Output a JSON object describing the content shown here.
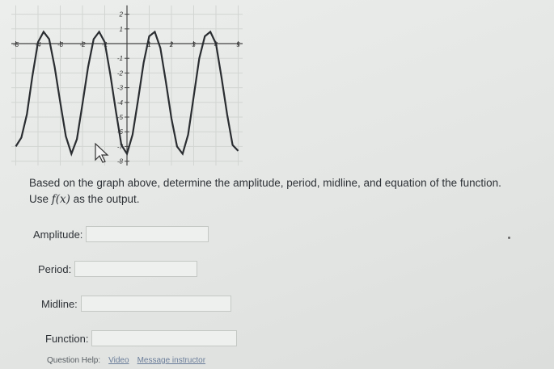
{
  "chart_data": {
    "type": "line",
    "x_tick_labels": [
      "-5",
      "-4",
      "-3",
      "-2",
      "-1",
      "1",
      "2",
      "3",
      "4",
      "5"
    ],
    "y_tick_labels": [
      "2",
      "1",
      "-1",
      "-2",
      "-3",
      "-4",
      "-5",
      "-6",
      "-7",
      "-8"
    ],
    "x_ticks": [
      -5,
      -4,
      -3,
      -2,
      -1,
      1,
      2,
      3,
      4,
      5
    ],
    "y_ticks": [
      2,
      1,
      -1,
      -2,
      -3,
      -4,
      -5,
      -6,
      -7,
      -8
    ],
    "xlim": [
      -5.2,
      5.2
    ],
    "ylim": [
      -8.3,
      2.6
    ],
    "series": [
      {
        "x": [
          -5.0,
          -4.75,
          -4.5,
          -4.25,
          -4.0,
          -3.75,
          -3.5,
          -3.25,
          -3.0,
          -2.75,
          -2.5,
          -2.25,
          -2.0,
          -1.75,
          -1.5,
          -1.25,
          -1.0,
          -0.75,
          -0.5,
          -0.25,
          0.0,
          0.25,
          0.5,
          0.75,
          1.0,
          1.25,
          1.5,
          1.75,
          2.0,
          2.25,
          2.5,
          2.75,
          3.0,
          3.25,
          3.5,
          3.75,
          4.0,
          4.25,
          4.5,
          4.75,
          5.0
        ],
        "y": [
          -7.0,
          -6.4,
          -4.8,
          -2.2,
          0.1,
          0.8,
          0.3,
          -1.6,
          -4.0,
          -6.3,
          -7.5,
          -6.5,
          -4.1,
          -1.6,
          0.3,
          0.8,
          0.1,
          -2.1,
          -4.6,
          -6.9,
          -7.5,
          -6.2,
          -3.8,
          -1.3,
          0.5,
          0.8,
          -0.3,
          -2.6,
          -5.1,
          -7.0,
          -7.5,
          -6.2,
          -3.6,
          -1.0,
          0.5,
          0.8,
          0.0,
          -2.3,
          -4.8,
          -6.9,
          -7.3
        ]
      }
    ]
  },
  "question": {
    "text_before": "Based on the graph above, determine the amplitude, period, midline, and equation of the function. Use ",
    "fx": "f(x)",
    "text_after": " as the output."
  },
  "fields": {
    "amplitude_label": "Amplitude:",
    "period_label": "Period:",
    "midline_label": "Midline:",
    "function_label": "Function:"
  },
  "footer": {
    "help_label": "Question Help:",
    "link1": "Video",
    "link2": "Message instructor"
  }
}
